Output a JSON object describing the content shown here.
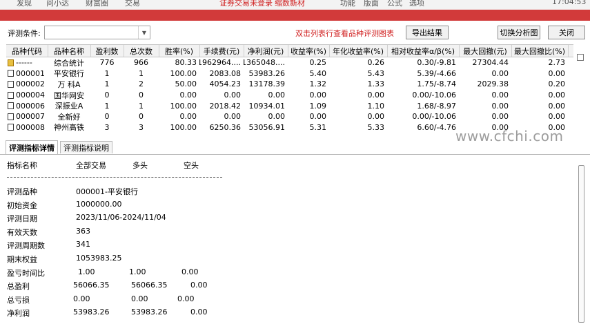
{
  "top_strip": {
    "items": [
      "发现",
      "问小达",
      "财富圈",
      "交易",
      "证券交易未登录",
      "缩数新材",
      "功能",
      "版面",
      "公式",
      "选项",
      "17:04:53"
    ]
  },
  "toolbar": {
    "condition_label": "评测条件:",
    "condition_value": "",
    "hint": "双击列表行查看品种评测图表",
    "export_label": "导出结果",
    "switch_label": "切换分析图",
    "close_label": "关闭"
  },
  "table": {
    "headers": [
      "品种代码",
      "品种名称",
      "盈利数",
      "总次数",
      "胜率(%)",
      "手续费(元)",
      "净利润(元)",
      "收益率(%)",
      "年化收益率(%)",
      "相对收益率α/β(%)",
      "最大回撤(元)",
      "最大回撤比(%)"
    ],
    "rows": [
      [
        "------",
        "综合统计",
        "776",
        "966",
        "80.33",
        "1962964....",
        "1365048....",
        "0.25",
        "0.26",
        "0.30/-9.81",
        "27304.44",
        "2.73"
      ],
      [
        "000001",
        "平安银行",
        "1",
        "1",
        "100.00",
        "2083.08",
        "53983.26",
        "5.40",
        "5.43",
        "5.39/-4.66",
        "0.00",
        "0.00"
      ],
      [
        "000002",
        "万 科A",
        "1",
        "2",
        "50.00",
        "4054.23",
        "13178.39",
        "1.32",
        "1.33",
        "1.75/-8.74",
        "2029.38",
        "0.20"
      ],
      [
        "000004",
        "国华网安",
        "0",
        "0",
        "0.00",
        "0.00",
        "0.00",
        "0.00",
        "0.00",
        "0.00/-10.06",
        "0.00",
        "0.00"
      ],
      [
        "000006",
        "深振业A",
        "1",
        "1",
        "100.00",
        "2018.42",
        "10934.01",
        "1.09",
        "1.10",
        "1.68/-8.97",
        "0.00",
        "0.00"
      ],
      [
        "000007",
        "全新好",
        "0",
        "0",
        "0.00",
        "0.00",
        "0.00",
        "0.00",
        "0.00",
        "0.00/-10.06",
        "0.00",
        "0.00"
      ],
      [
        "000008",
        "神州高铁",
        "3",
        "3",
        "100.00",
        "6250.36",
        "53056.91",
        "5.31",
        "5.33",
        "6.60/-4.76",
        "0.00",
        "0.00"
      ]
    ]
  },
  "tabs": [
    "评测指标详情",
    "评测指标说明"
  ],
  "detail": {
    "header": [
      "指标名称",
      "全部交易",
      "多头",
      "空头"
    ],
    "lines": [
      {
        "name": "评测品种",
        "v1": "000001-平安银行",
        "v2": "",
        "v3": ""
      },
      {
        "name": "初始资金",
        "v1": "1000000.00",
        "v2": "",
        "v3": ""
      },
      {
        "name": "评测日期",
        "v1": "2023/11/06-2024/11/04",
        "v2": "",
        "v3": ""
      },
      {
        "name": "有效天数",
        "v1": "363",
        "v2": "",
        "v3": ""
      },
      {
        "name": "评测周期数",
        "v1": "341",
        "v2": "",
        "v3": ""
      },
      {
        "name": "期末权益",
        "v1": "1053983.25",
        "v2": "",
        "v3": ""
      },
      {
        "name": "盈亏时间比",
        "v1": "1.00",
        "v2": "1.00",
        "v3": "0.00"
      },
      {
        "name": "总盈利",
        "v1": "56066.35",
        "v2": "56066.35",
        "v3": "0.00"
      },
      {
        "name": "总亏损",
        "v1": "0.00",
        "v2": "0.00",
        "v3": "0.00"
      },
      {
        "name": "净利润",
        "v1": "53983.26",
        "v2": "53983.26",
        "v3": "0.00"
      }
    ]
  },
  "watermark": "www.cfchi.com",
  "colors": {
    "red_bar": "#d23a3a",
    "hint_red": "#d02020"
  }
}
